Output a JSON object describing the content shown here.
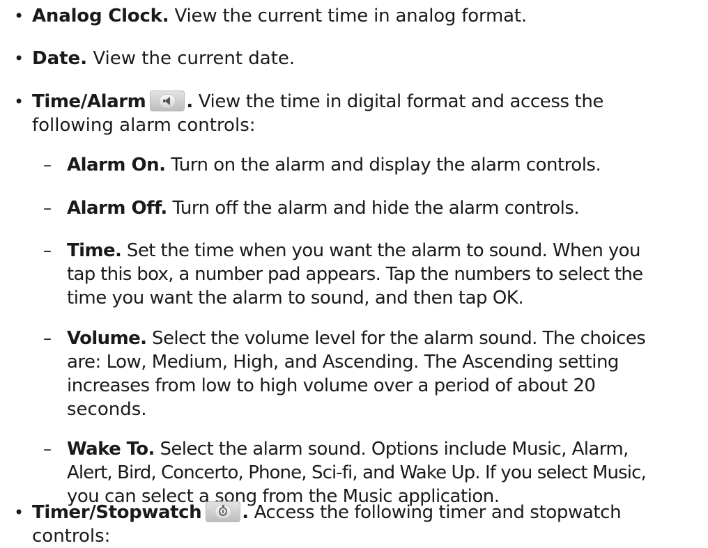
{
  "bullet_glyph": "•",
  "dash_glyph": "–",
  "items": [
    {
      "term": "Analog Clock.",
      "lines": [
        " View the current time in analog format."
      ]
    },
    {
      "term": "Date.",
      "lines": [
        " View the current date."
      ]
    },
    {
      "term": "Time/Alarm",
      "icon": "alarm-bell-icon",
      "after_icon": ".",
      "lines": [
        " View the time in digital format and access the",
        "following alarm controls:"
      ]
    },
    {
      "term": "Timer/Stopwatch",
      "icon": "stopwatch-icon",
      "after_icon": ".",
      "lines": [
        " Access the following timer and stopwatch",
        "controls:"
      ]
    }
  ],
  "subitems": [
    {
      "term": "Alarm On.",
      "lines": [
        " Turn on the alarm and display the alarm controls."
      ]
    },
    {
      "term": "Alarm Off.",
      "lines": [
        " Turn off the alarm and hide the alarm controls."
      ]
    },
    {
      "term": "Time.",
      "lines": [
        " Set the time when you want the alarm to sound. When you",
        "tap this box, a number pad appears. Tap the numbers to select the",
        "time you want the alarm to sound, and then tap OK."
      ]
    },
    {
      "term": "Volume.",
      "lines": [
        " Select the volume level for the alarm sound. The choices",
        "are: Low, Medium, High, and Ascending. The Ascending setting",
        "increases from low to high volume over a period of about 20",
        "seconds."
      ]
    },
    {
      "term": "Wake To.",
      "lines": [
        " Select the alarm sound. Options include Music, Alarm,",
        "Alert, Bird, Concerto, Phone, Sci-fi, and Wake Up. If you select Music,",
        "you can select a song from the Music application."
      ]
    }
  ]
}
